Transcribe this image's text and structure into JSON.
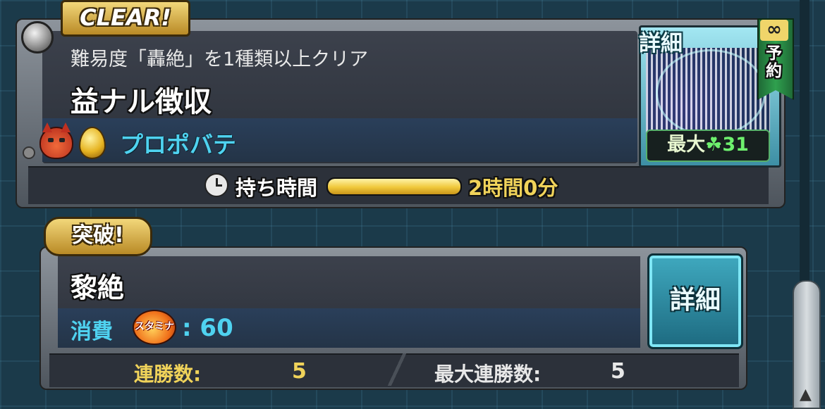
{
  "quest_card": {
    "clear_badge": "CLEAR!",
    "condition": "難易度「轟絶」を1種類以上クリア",
    "quest_name": "益ナル徴収",
    "monster_name": "プロポバテ",
    "detail_label": "詳細",
    "max_label": "最大",
    "max_clover_count": "31",
    "ribbon_infinity": "∞",
    "ribbon_text": "予約",
    "time_label": "持ち時間",
    "time_value": "2時間0分",
    "time_fill_fraction": 1.0
  },
  "breakthrough_card": {
    "badge": "突破!",
    "stage_name": "黎絶",
    "cost_label": "消費",
    "stamina_label": "スタミナ",
    "cost_value": ": 60",
    "detail_button": "詳細",
    "streak_label": "連勝数:",
    "streak_value": "5",
    "max_streak_label": "最大連勝数:",
    "max_streak_value": "5"
  },
  "icons": [
    "clock-icon",
    "devil-element-icon",
    "gold-egg-icon",
    "clover-icon",
    "stamina-icon"
  ],
  "colors": {
    "accent_cyan": "#4fd2f0",
    "gold": "#f0d35a",
    "clover_green": "#6ef06e"
  }
}
